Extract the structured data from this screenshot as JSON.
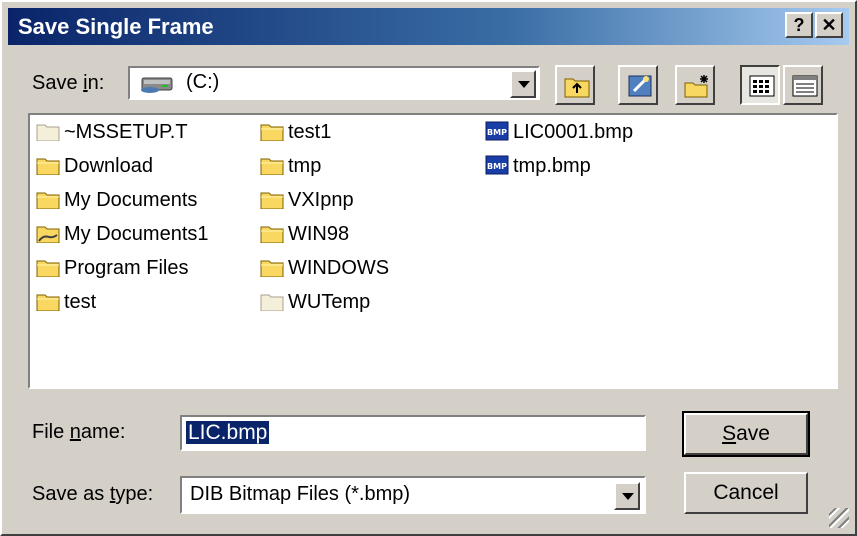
{
  "window": {
    "title": "Save Single Frame",
    "help_button": "?",
    "close_button": "✕"
  },
  "save_in": {
    "label_prefix": "Save ",
    "label_mnemonic": "i",
    "label_suffix": "n:",
    "value": "(C:)",
    "icon": "drive-icon"
  },
  "toolbar": {
    "buttons": [
      {
        "name": "up-one-level-button",
        "icon": "up-folder-icon"
      },
      {
        "name": "go-to-desktop-button",
        "icon": "desktop-icon"
      },
      {
        "name": "create-new-folder-button",
        "icon": "new-folder-icon"
      },
      {
        "name": "list-view-button",
        "icon": "list-view-icon",
        "pressed": true
      },
      {
        "name": "details-view-button",
        "icon": "details-view-icon"
      }
    ]
  },
  "files": {
    "items": [
      {
        "label": "~MSSETUP.T",
        "icon": "hidden-folder-icon"
      },
      {
        "label": "Download",
        "icon": "folder-icon"
      },
      {
        "label": "My Documents",
        "icon": "folder-icon"
      },
      {
        "label": "My Documents1",
        "icon": "shared-folder-icon"
      },
      {
        "label": "Program Files",
        "icon": "folder-icon"
      },
      {
        "label": "test",
        "icon": "folder-icon"
      },
      {
        "label": "test1",
        "icon": "folder-icon"
      },
      {
        "label": "tmp",
        "icon": "folder-icon"
      },
      {
        "label": "VXIpnp",
        "icon": "folder-icon"
      },
      {
        "label": "WIN98",
        "icon": "folder-icon"
      },
      {
        "label": "WINDOWS",
        "icon": "folder-icon"
      },
      {
        "label": "WUTemp",
        "icon": "hidden-folder-icon"
      },
      {
        "label": "LIC0001.bmp",
        "icon": "bmp-file-icon"
      },
      {
        "label": "tmp.bmp",
        "icon": "bmp-file-icon"
      }
    ]
  },
  "file_name": {
    "label_prefix": "File ",
    "label_mnemonic": "n",
    "label_suffix": "ame:",
    "value": "LIC.bmp"
  },
  "save_as_type": {
    "label_prefix": "Save as ",
    "label_mnemonic": "t",
    "label_suffix": "ype:",
    "value": "DIB Bitmap Files (*.bmp)"
  },
  "buttons": {
    "save_mnemonic": "S",
    "save_rest": "ave",
    "cancel": "Cancel"
  },
  "colors": {
    "titlebar_start": "#0a246a",
    "titlebar_end": "#a6caf0",
    "face": "#d4d0c8",
    "selection": "#0a246a",
    "folder_yellow": "#f8d860"
  }
}
